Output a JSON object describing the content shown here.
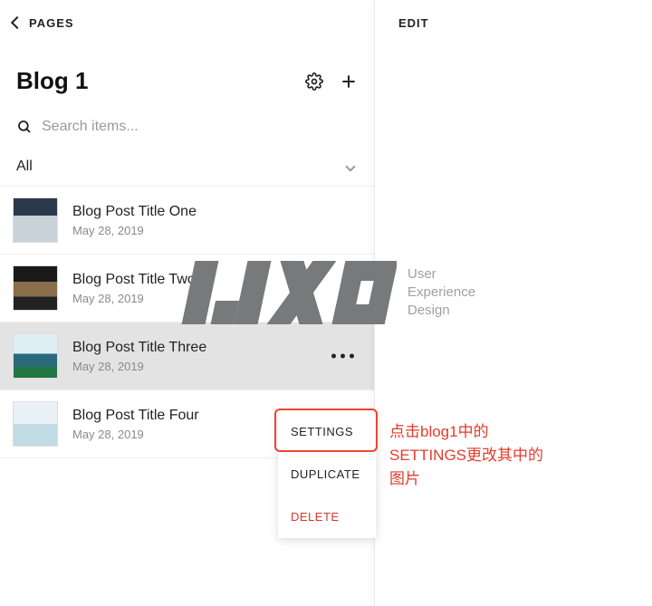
{
  "back_label": "PAGES",
  "title": "Blog 1",
  "search": {
    "placeholder": "Search items..."
  },
  "filter_label": "All",
  "edit_label": "EDIT",
  "posts": [
    {
      "title": "Blog Post Title One",
      "date": "May 28, 2019"
    },
    {
      "title": "Blog Post Title Two",
      "date": "May 28, 2019"
    },
    {
      "title": "Blog Post Title Three",
      "date": "May 28, 2019"
    },
    {
      "title": "Blog Post Title Four",
      "date": "May 28, 2019"
    }
  ],
  "context_menu": {
    "settings": "SETTINGS",
    "duplicate": "DUPLICATE",
    "delete": "DELETE"
  },
  "watermark": {
    "line1": "User",
    "line2": "Experience",
    "line3": "Design"
  },
  "annotation": {
    "line1": "点击blog1中的",
    "line2": "SETTINGS更改其中的",
    "line3": "图片"
  }
}
